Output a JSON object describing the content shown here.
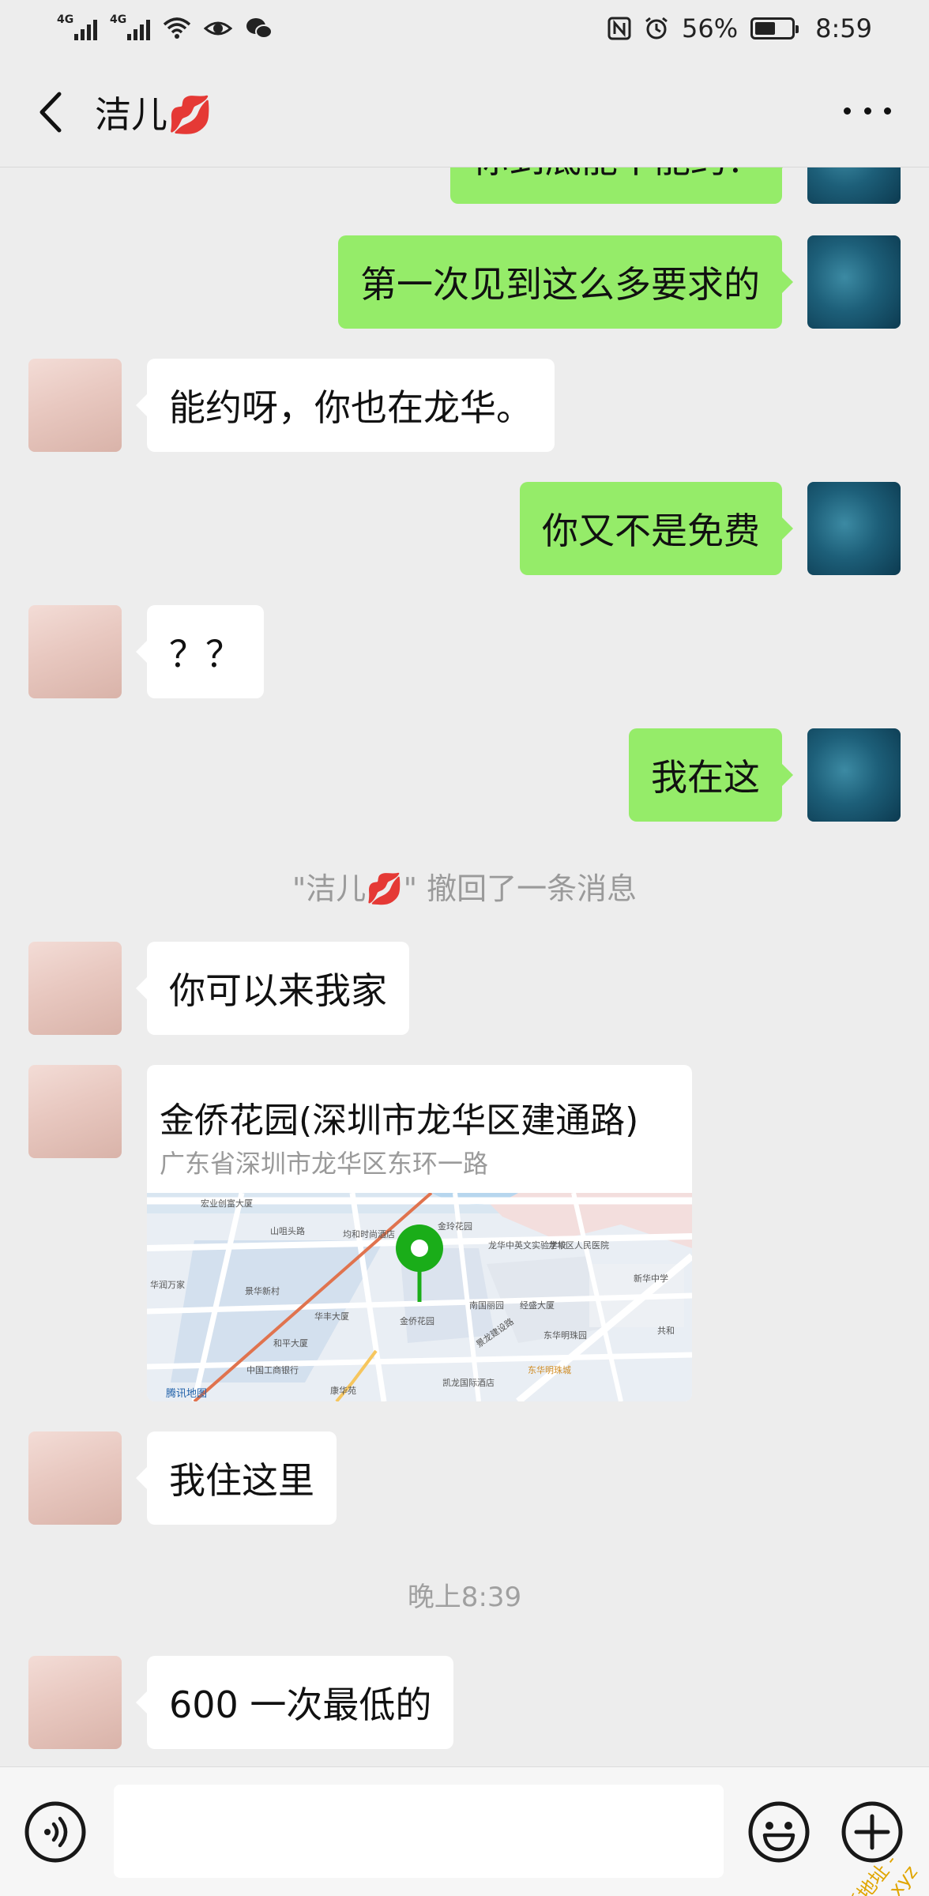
{
  "status_bar": {
    "net1": "4G",
    "net2": "4G",
    "battery_percent": "56%",
    "battery_level": 0.56,
    "time": "8:59"
  },
  "header": {
    "title": "洁儿💋"
  },
  "messages": {
    "m0_text": "你到底能不能约？",
    "m1_text": "第一次见到这么多要求的",
    "m2_text": "能约呀，你也在龙华。",
    "m3_text": "你又不是免费",
    "m4_text": "？？",
    "m5_text": "我在这",
    "recall_notice": "\"洁儿💋\" 撤回了一条消息",
    "m6_text": "你可以来我家",
    "m8_text": "我住这里",
    "time_divider": "晚上8:39",
    "m9_text": "600 一次最低的"
  },
  "location": {
    "name": "金侨花园(深圳市龙华区建通路)",
    "address": "广东省深圳市龙华区东环一路",
    "map_labels": {
      "l1": "宏业创富大厦",
      "l2": "山咀头路",
      "l3": "均和时尚酒店",
      "l4": "金玲花园",
      "l5": "龙华中英文实验学校",
      "l6": "龙华区人民医院",
      "l7": "新华中学",
      "l8": "景华新村",
      "l9": "华润万家",
      "l10": "华丰大厦",
      "l11": "和平大厦",
      "l12": "中国工商银行",
      "l13": "金侨花园",
      "l14": "南国丽园",
      "l15": "经盛大厦",
      "l16": "东华明珠园",
      "l17": "东华明珠城",
      "l18": "凯龙国际酒店",
      "l19": "康华苑",
      "l20": "共和",
      "l21": "景龙建设路",
      "l22": "腾讯地图"
    }
  },
  "watermark": {
    "line1": "- 最新地址 -",
    "line2": "caofree.xyz"
  },
  "colors": {
    "background": "#ededed",
    "outgoing_bubble": "#95ec69",
    "incoming_bubble": "#ffffff",
    "map_pin": "#1aad19"
  }
}
